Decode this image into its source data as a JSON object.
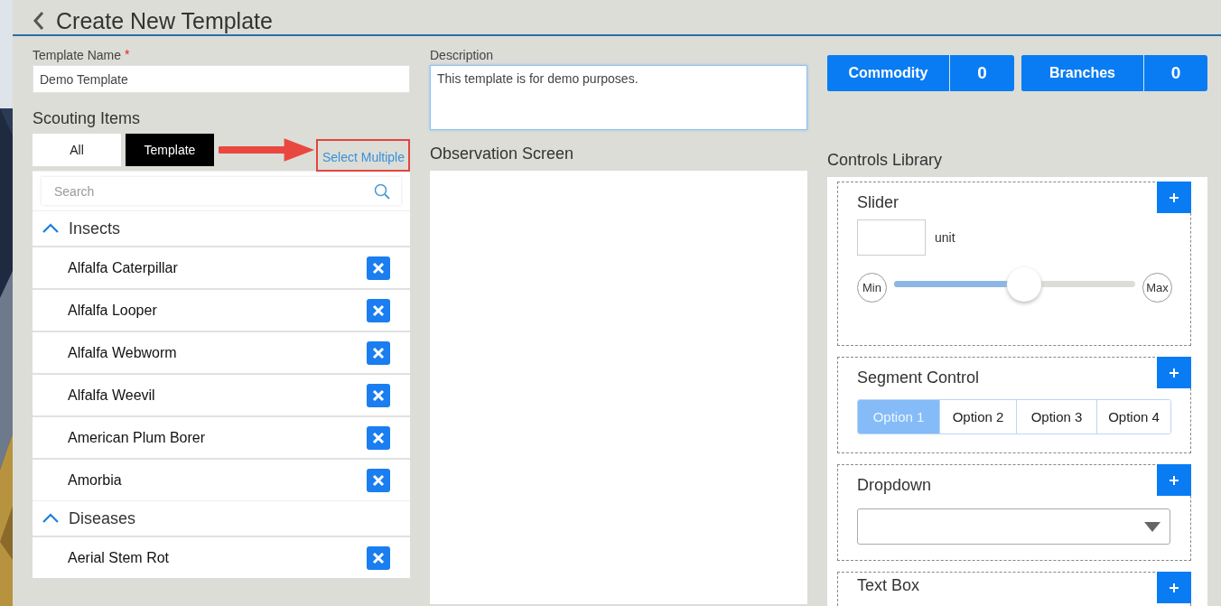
{
  "header": {
    "title": "Create New Template"
  },
  "template_name": {
    "label": "Template Name",
    "required_marker": "*",
    "value": "Demo Template"
  },
  "description": {
    "label": "Description",
    "value": "This template is for demo purposes."
  },
  "counters": [
    {
      "label": "Commodity",
      "count": "0"
    },
    {
      "label": "Branches",
      "count": "0"
    }
  ],
  "scouting": {
    "title": "Scouting Items",
    "tabs": [
      {
        "label": "All",
        "selected": false
      },
      {
        "label": "Template",
        "selected": true
      }
    ],
    "select_multiple": "Select Multiple",
    "search": {
      "placeholder": "Search"
    },
    "groups": [
      {
        "name": "Insects",
        "expanded": true,
        "items": [
          "Alfalfa Caterpillar",
          "Alfalfa Looper",
          "Alfalfa Webworm",
          "Alfalfa Weevil",
          "American Plum Borer",
          "Amorbia"
        ]
      },
      {
        "name": "Diseases",
        "expanded": true,
        "items": [
          "Aerial Stem Rot"
        ]
      }
    ]
  },
  "observation": {
    "title": "Observation Screen"
  },
  "library": {
    "title": "Controls Library",
    "controls": [
      {
        "kind": "slider",
        "title": "Slider",
        "unit": "unit",
        "min": "Min",
        "max": "Max",
        "level": 0.54
      },
      {
        "kind": "segment",
        "title": "Segment Control",
        "options": [
          {
            "label": "Option 1",
            "selected": true
          },
          {
            "label": "Option 2",
            "selected": false
          },
          {
            "label": "Option 3",
            "selected": false
          },
          {
            "label": "Option 4",
            "selected": false
          }
        ]
      },
      {
        "kind": "dropdown",
        "title": "Dropdown"
      },
      {
        "kind": "textbox",
        "title": "Text Box"
      }
    ]
  }
}
